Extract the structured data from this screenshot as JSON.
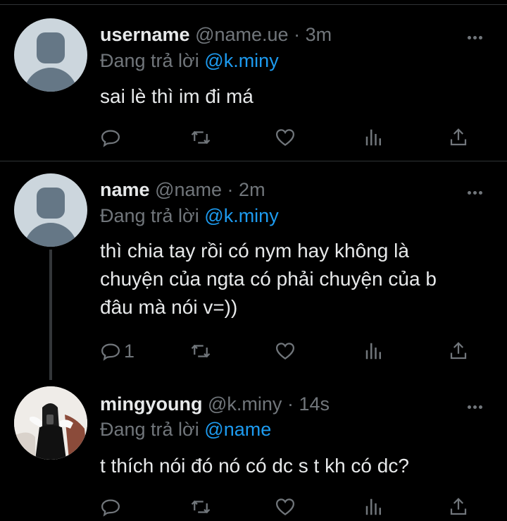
{
  "tweets": [
    {
      "name": "username",
      "handle": "@name.ue",
      "dot": "·",
      "time": "3m",
      "reply_prefix": "Đang trả lời",
      "reply_to": "@k.miny",
      "text": "sai lè thì im đi má",
      "reply_count": ""
    },
    {
      "name": "name",
      "handle": "@name",
      "dot": "·",
      "time": "2m",
      "reply_prefix": "Đang trả lời",
      "reply_to": "@k.miny",
      "text": "thì chia tay rồi có nym hay không là chuyện của ngta có phải chuyện của b đâu mà nói v=))",
      "reply_count": "1"
    },
    {
      "name": "mingyoung",
      "handle": "@k.miny",
      "dot": "·",
      "time": "14s",
      "reply_prefix": "Đang trả lời",
      "reply_to": "@name",
      "text": "t thích nói đó nó có dc s t kh có dc?",
      "reply_count": ""
    }
  ],
  "icons": [
    "reply-icon",
    "retweet-icon",
    "like-icon",
    "analytics-icon",
    "share-icon",
    "more-icon"
  ],
  "colors": {
    "background": "#000000",
    "text": "#e7e9ea",
    "muted": "#71767b",
    "accent": "#1d9bf0"
  }
}
